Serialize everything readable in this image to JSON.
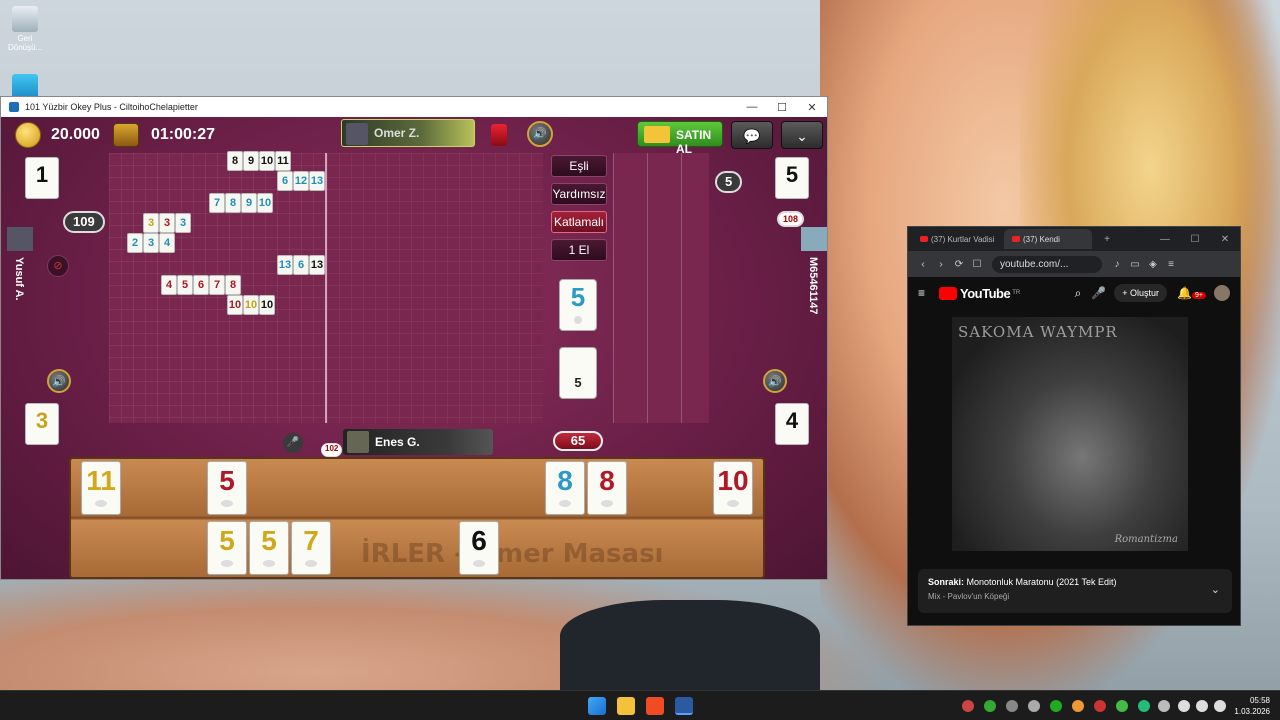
{
  "desktop": {
    "icons": [
      {
        "label": "Geri Dönüşü...",
        "icon": "recycle-bin-icon"
      },
      {
        "label": "",
        "icon": "app-shortcut-icon"
      }
    ]
  },
  "game_window": {
    "title": "101 Yüzbir Okey Plus - CiltoihoChelapietter",
    "controls": {
      "minimize": "—",
      "maximize": "☐",
      "close": "✕"
    },
    "top": {
      "coins": "20.000",
      "timer": "01:00:27",
      "opponent_top": "Omer Z.",
      "buy_button": "SATIN AL",
      "chat_icon": "💬",
      "menu_icon": "⌄"
    },
    "corners": {
      "top_left_tile": "1",
      "top_left_score": "109",
      "top_right_tile": "5",
      "top_right_score": "5",
      "bottom_left_tile": "3",
      "bottom_right_tile": "4"
    },
    "players": {
      "left": "Yusuf A.",
      "right": "M65461147",
      "bottom": "Enes G.",
      "right_badge": "108",
      "bottom_badge": "102"
    },
    "melds": [
      {
        "tiles": [
          {
            "n": "8",
            "c": "black"
          },
          {
            "n": "9",
            "c": "black"
          },
          {
            "n": "10",
            "c": "black"
          },
          {
            "n": "11",
            "c": "black"
          }
        ]
      },
      {
        "tiles": [
          {
            "n": "6",
            "c": "blue"
          },
          {
            "n": "12",
            "c": "blue"
          },
          {
            "n": "13",
            "c": "blue"
          }
        ]
      },
      {
        "tiles": [
          {
            "n": "7",
            "c": "blue"
          },
          {
            "n": "8",
            "c": "blue"
          },
          {
            "n": "9",
            "c": "blue"
          },
          {
            "n": "10",
            "c": "blue"
          }
        ]
      },
      {
        "tiles": [
          {
            "n": "3",
            "c": "yellow"
          },
          {
            "n": "3",
            "c": "red"
          },
          {
            "n": "3",
            "c": "blue"
          }
        ]
      },
      {
        "tiles": [
          {
            "n": "2",
            "c": "blue"
          },
          {
            "n": "3",
            "c": "blue"
          },
          {
            "n": "4",
            "c": "blue"
          }
        ]
      },
      {
        "tiles": [
          {
            "n": "13",
            "c": "blue"
          },
          {
            "n": "6",
            "c": "blue"
          },
          {
            "n": "13",
            "c": "black"
          }
        ]
      },
      {
        "tiles": [
          {
            "n": "4",
            "c": "red"
          },
          {
            "n": "5",
            "c": "red"
          },
          {
            "n": "6",
            "c": "red"
          },
          {
            "n": "7",
            "c": "red"
          },
          {
            "n": "8",
            "c": "red"
          }
        ]
      },
      {
        "tiles": [
          {
            "n": "10",
            "c": "red"
          },
          {
            "n": "10",
            "c": "yellow"
          },
          {
            "n": "10",
            "c": "black"
          }
        ]
      }
    ],
    "options": [
      "Eşli",
      "Yardımsız",
      "Katlamalı",
      "1 El"
    ],
    "indicator_tile": "5",
    "deck_tile": "5",
    "remaining": "65",
    "rack_top": [
      {
        "n": "11",
        "c": "yellow"
      },
      {
        "n": "5",
        "c": "red"
      },
      {
        "n": "8",
        "c": "blue"
      },
      {
        "n": "8",
        "c": "red"
      },
      {
        "n": "10",
        "c": "red"
      }
    ],
    "rack_bottom": [
      {
        "n": "5",
        "c": "yellow"
      },
      {
        "n": "5",
        "c": "yellow"
      },
      {
        "n": "7",
        "c": "yellow"
      },
      {
        "n": "6",
        "c": "black"
      }
    ],
    "rack_watermark": "İRLER - Omer Masası"
  },
  "browser": {
    "tabs": [
      {
        "label": "(37) Kurtlar Vadisi"
      },
      {
        "label": "(37) Kendi"
      }
    ],
    "new_tab": "+",
    "url": "youtube.com/...",
    "youtube": {
      "brand": "YouTube",
      "region": "TR",
      "create": "Oluştur",
      "notifications": "9+"
    },
    "video": {
      "title_overlay": "SAKOMA WAYMPR",
      "signature": "Romantizma"
    },
    "up_next": {
      "prefix": "Sonraki:",
      "title": "Monotonluk Maratonu (2021 Tek Edit)",
      "sub": "Mix - Pavlov'un Köpeği"
    }
  },
  "taskbar": {
    "time": "05:58",
    "date": "1.03.2026"
  }
}
